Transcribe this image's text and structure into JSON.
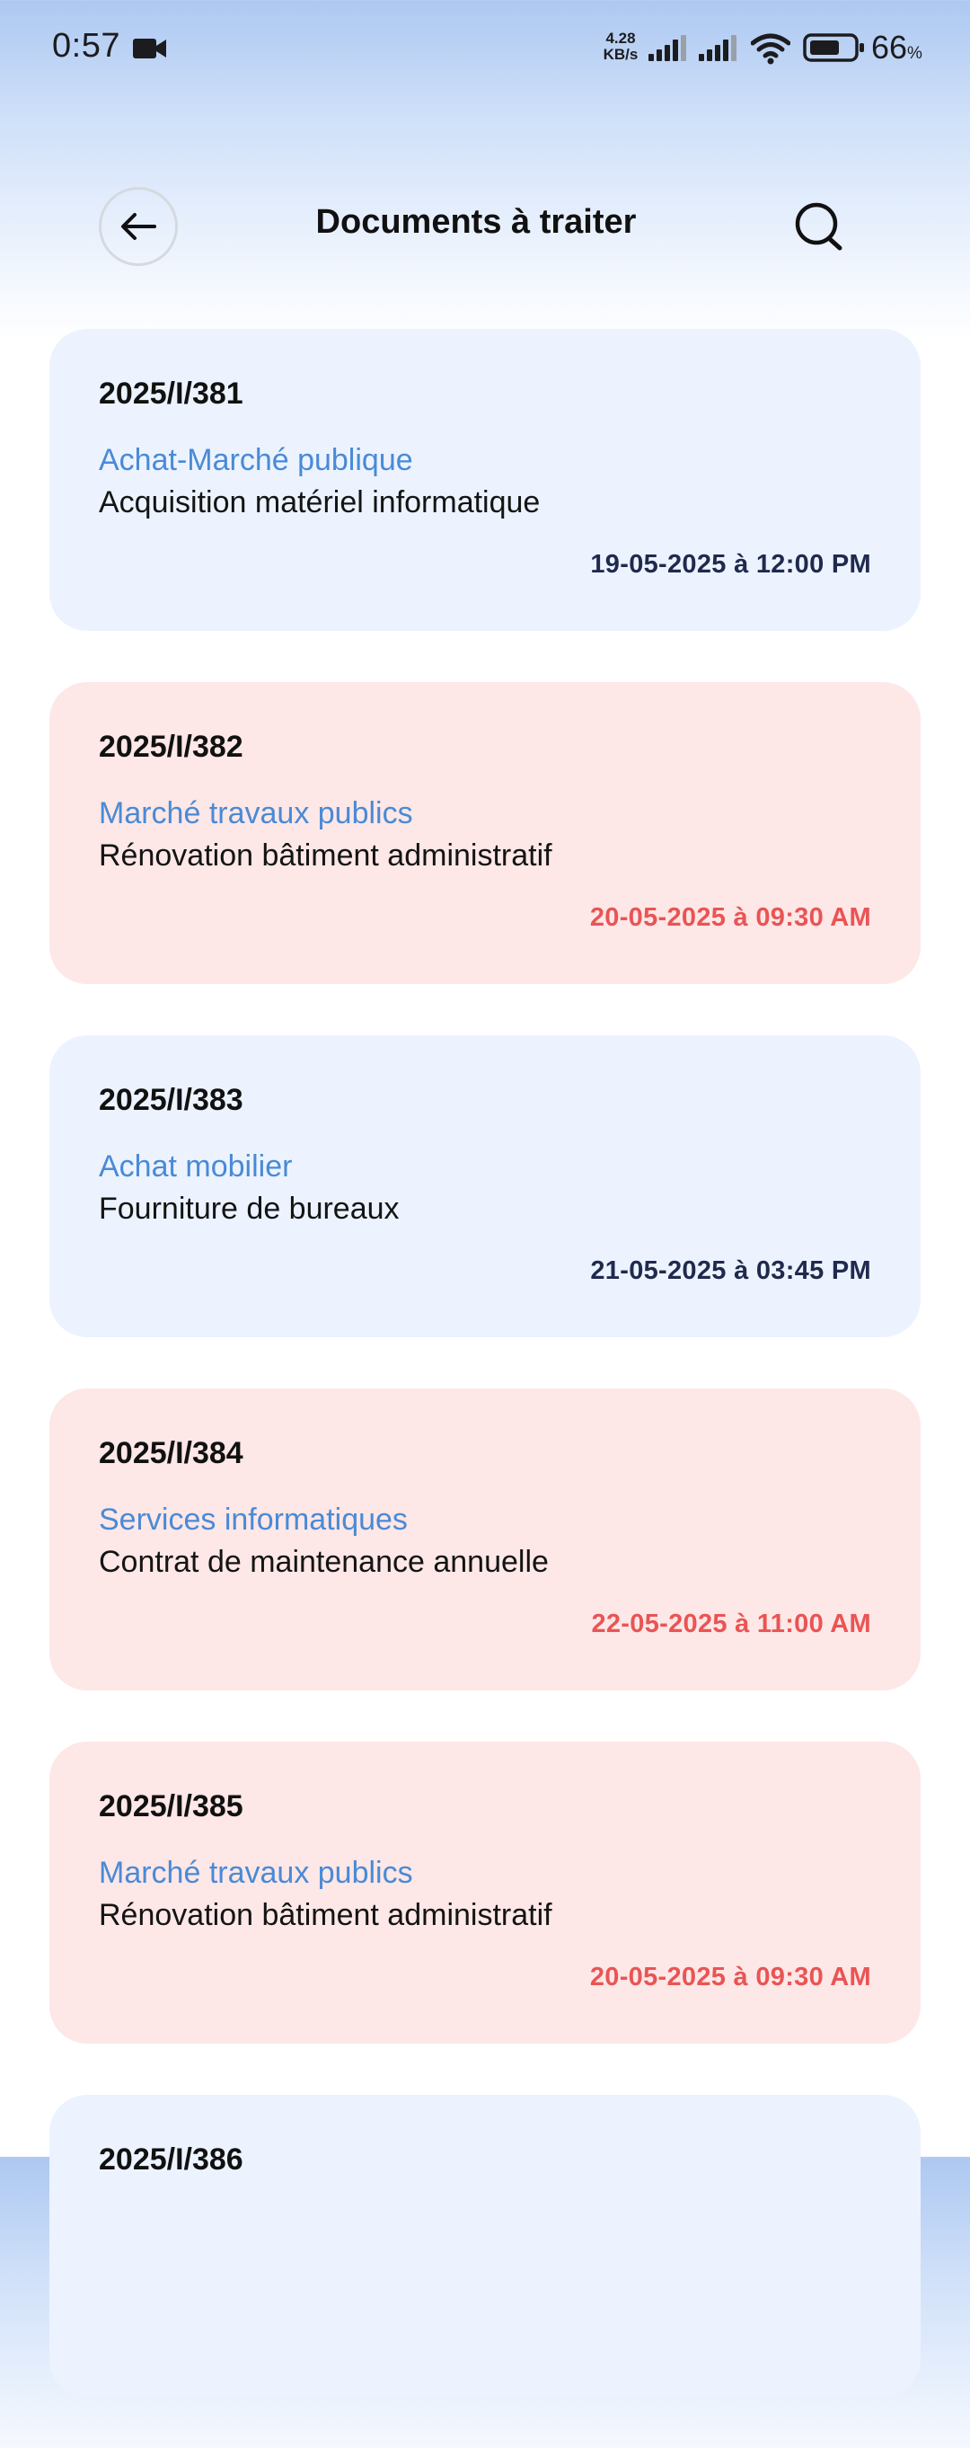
{
  "status_bar": {
    "time": "0:57",
    "network_speed_value": "4.28",
    "network_speed_unit": "KB/s",
    "battery_percent": "66",
    "battery_percent_sign": "%",
    "icons": [
      "video-camera-icon",
      "signal-icon",
      "signal-icon",
      "wifi-icon",
      "battery-icon"
    ]
  },
  "header": {
    "title": "Documents à traiter",
    "back_icon": "arrow-left-icon",
    "search_icon": "search-icon"
  },
  "colors": {
    "normal_card_bg": "#ecf3ff",
    "urgent_card_bg": "#fde7e7",
    "category_text": "#4a8ad6",
    "normal_date_text": "#1f2a4d",
    "urgent_date_text": "#ea5454"
  },
  "documents": [
    {
      "reference": "2025/I/381",
      "category": "Achat-Marché publique",
      "subject": "Acquisition matériel informatique",
      "date": "19-05-2025 à 12:00 PM",
      "status": "normal"
    },
    {
      "reference": "2025/I/382",
      "category": "Marché travaux publics",
      "subject": "Rénovation bâtiment administratif",
      "date": "20-05-2025 à 09:30 AM",
      "status": "urgent"
    },
    {
      "reference": "2025/I/383",
      "category": "Achat mobilier",
      "subject": "Fourniture de bureaux",
      "date": "21-05-2025 à 03:45 PM",
      "status": "normal"
    },
    {
      "reference": "2025/I/384",
      "category": "Services informatiques",
      "subject": "Contrat de maintenance annuelle",
      "date": "22-05-2025 à 11:00 AM",
      "status": "urgent"
    },
    {
      "reference": "2025/I/385",
      "category": "Marché travaux publics",
      "subject": "Rénovation bâtiment administratif",
      "date": "20-05-2025 à 09:30 AM",
      "status": "urgent"
    },
    {
      "reference": "2025/I/386",
      "category": "",
      "subject": "",
      "date": "",
      "status": "normal"
    }
  ]
}
